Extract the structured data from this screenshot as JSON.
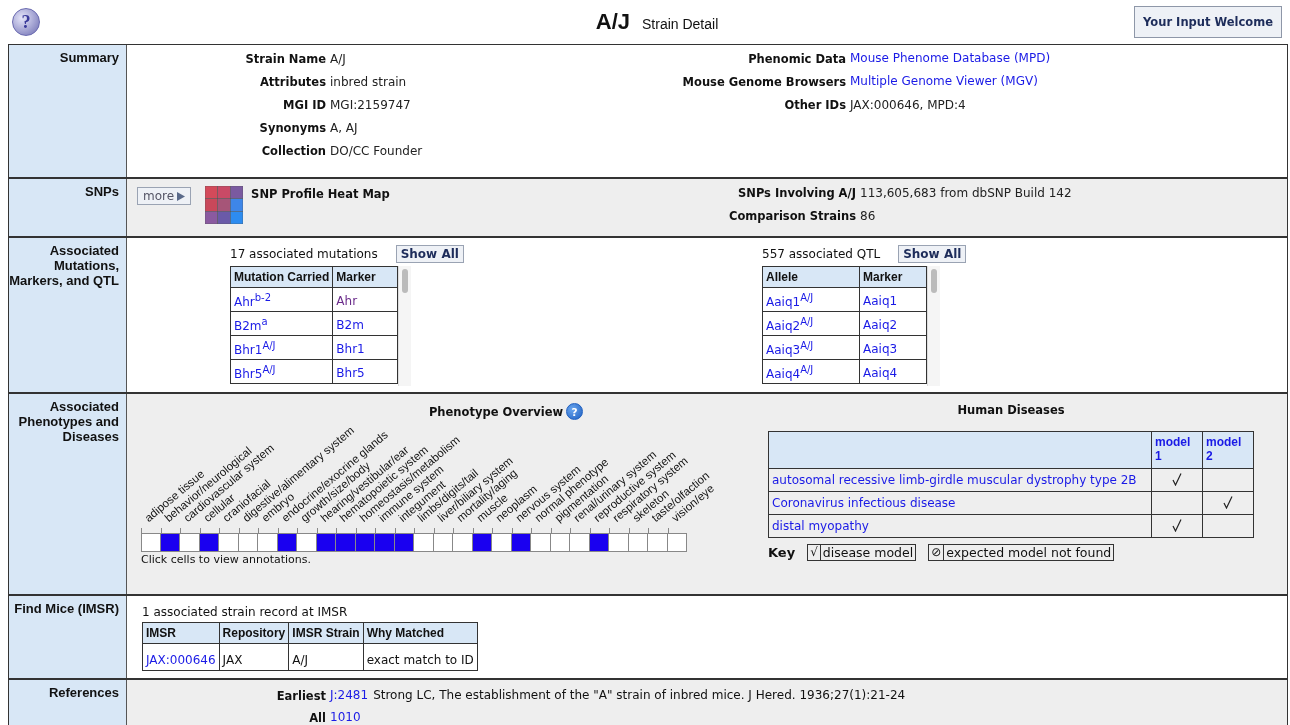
{
  "header": {
    "help_icon": "?",
    "title": "A/J",
    "subtitle": "Strain Detail",
    "feedback_button": "Your Input Welcome"
  },
  "sections": [
    {
      "kind": "summary",
      "label": "Summary",
      "left": [
        {
          "label": "Strain Name",
          "value": "A/J",
          "link": false
        },
        {
          "label": "Attributes",
          "value": "inbred strain",
          "link": false
        },
        {
          "label": "MGI ID",
          "value": "MGI:2159747",
          "link": false
        },
        {
          "label": "Synonyms",
          "value": "A, AJ",
          "link": false
        },
        {
          "label": "Collection",
          "value": "DO/CC Founder",
          "link": false
        }
      ],
      "right": [
        {
          "label": "Phenomic Data",
          "value": "Mouse Phenome Database (MPD)",
          "link": true
        },
        {
          "label": "Mouse Genome Browsers",
          "value": "Multiple Genome Viewer (MGV)",
          "link": true
        },
        {
          "label": "Other IDs",
          "value": "JAX:000646, MPD:4",
          "link": false
        }
      ]
    },
    {
      "kind": "snps",
      "label": "SNPs",
      "more_button": "more",
      "heat_map_label": "SNP Profile Heat Map",
      "right": [
        {
          "label": "SNPs Involving A/J",
          "value": "113,605,683 from dbSNP Build 142",
          "link": false
        },
        {
          "label": "Comparison Strains",
          "value": "86",
          "link": false
        }
      ]
    },
    {
      "kind": "mutations",
      "label": "Associated Mutations, Markers, and QTL",
      "tables": [
        {
          "count": "17 associated mutations",
          "button": "Show All",
          "columns": [
            "Mutation Carried",
            "Marker"
          ],
          "rows": [
            {
              "allele": "Ahr$^{b-2}$",
              "marker": "Ahr",
              "visited": true
            },
            {
              "allele": "B2m$^{a}$",
              "marker": "B2m",
              "visited": false
            },
            {
              "allele": "Bhr1$^{A/J}$",
              "marker": "Bhr1",
              "visited": false
            },
            {
              "allele": "Bhr5$^{A/J}$",
              "marker": "Bhr5",
              "visited": false
            }
          ]
        },
        {
          "count": "557 associated QTL",
          "button": "Show All",
          "columns": [
            "Allele",
            "Marker"
          ],
          "rows": [
            {
              "allele": "Aaiq1$^{A/J}$",
              "marker": "Aaiq1",
              "visited": false
            },
            {
              "allele": "Aaiq2$^{A/J}$",
              "marker": "Aaiq2",
              "visited": false
            },
            {
              "allele": "Aaiq3$^{A/J}$",
              "marker": "Aaiq3",
              "visited": false
            },
            {
              "allele": "Aaiq4$^{A/J}$",
              "marker": "Aaiq4",
              "visited": false
            }
          ]
        }
      ]
    },
    {
      "kind": "phenotypes",
      "label": "Associated Phenotypes and Diseases",
      "overview": {
        "title": "Phenotype Overview",
        "help_icon": "?",
        "hint": "Click cells to view annotations.",
        "systems": [
          {
            "label": "adipose tissue",
            "annotated": false
          },
          {
            "label": "behavior/neurological",
            "annotated": true
          },
          {
            "label": "cardiovascular system",
            "annotated": false
          },
          {
            "label": "cellular",
            "annotated": true
          },
          {
            "label": "craniofacial",
            "annotated": false
          },
          {
            "label": "digestive/alimentary system",
            "annotated": false
          },
          {
            "label": "embryo",
            "annotated": false
          },
          {
            "label": "endocrine/exocrine glands",
            "annotated": true
          },
          {
            "label": "growth/size/body",
            "annotated": false
          },
          {
            "label": "hearing/vestibular/ear",
            "annotated": true
          },
          {
            "label": "hematopoietic system",
            "annotated": true
          },
          {
            "label": "homeostasis/metabolism",
            "annotated": true
          },
          {
            "label": "immune system",
            "annotated": true
          },
          {
            "label": "integument",
            "annotated": true
          },
          {
            "label": "limbs/digits/tail",
            "annotated": false
          },
          {
            "label": "liver/biliary system",
            "annotated": false
          },
          {
            "label": "mortality/aging",
            "annotated": false
          },
          {
            "label": "muscle",
            "annotated": true
          },
          {
            "label": "neoplasm",
            "annotated": false
          },
          {
            "label": "nervous system",
            "annotated": true
          },
          {
            "label": "normal phenotype",
            "annotated": false
          },
          {
            "label": "pigmentation",
            "annotated": false
          },
          {
            "label": "renal/urinary system",
            "annotated": false
          },
          {
            "label": "reproductive system",
            "annotated": true
          },
          {
            "label": "respiratory system",
            "annotated": false
          },
          {
            "label": "skeleton",
            "annotated": false
          },
          {
            "label": "taste/olfaction",
            "annotated": false
          },
          {
            "label": "vision/eye",
            "annotated": false
          }
        ]
      },
      "diseases": {
        "title": "Human Diseases",
        "columns": [
          "model 1",
          "model 2"
        ],
        "rows": [
          {
            "name": "autosomal recessive limb-girdle muscular dystrophy type 2B",
            "models": [
              true,
              false
            ]
          },
          {
            "name": "Coronavirus infectious disease",
            "models": [
              false,
              true
            ]
          },
          {
            "name": "distal myopathy",
            "models": [
              true,
              false
            ]
          }
        ],
        "key_label": "Key",
        "key": [
          {
            "symbol": "√",
            "text": "disease model"
          },
          {
            "symbol": "⊘",
            "text": "expected model not found"
          }
        ]
      }
    },
    {
      "kind": "mice",
      "label": "Find Mice (IMSR)",
      "summary": "1 associated strain record at IMSR",
      "columns": [
        "IMSR",
        "Repository",
        "IMSR Strain",
        "Why Matched"
      ],
      "rows": [
        [
          "JAX:000646",
          "JAX",
          "A/J",
          "exact match to ID"
        ]
      ]
    },
    {
      "kind": "references",
      "label": "References",
      "items": [
        {
          "label": "Earliest",
          "link": "J:2481",
          "text": "Strong LC, The establishment of the \"A\" strain of inbred mice. J Hered. 1936;27(1):21-24"
        },
        {
          "label": "All",
          "link": "1010"
        }
      ]
    }
  ]
}
